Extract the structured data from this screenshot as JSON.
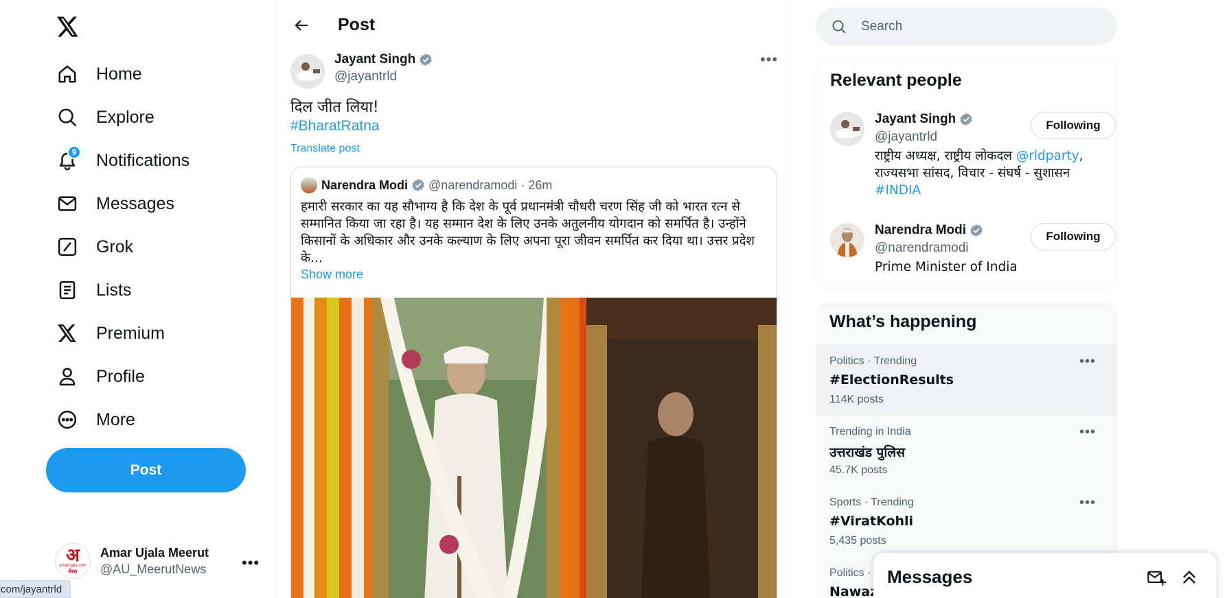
{
  "nav": {
    "items": [
      {
        "label": "Home",
        "icon": "home-icon"
      },
      {
        "label": "Explore",
        "icon": "search-icon"
      },
      {
        "label": "Notifications",
        "icon": "bell-icon",
        "badge": "9"
      },
      {
        "label": "Messages",
        "icon": "envelope-icon"
      },
      {
        "label": "Grok",
        "icon": "grok-icon"
      },
      {
        "label": "Lists",
        "icon": "list-icon"
      },
      {
        "label": "Premium",
        "icon": "x-logo-icon"
      },
      {
        "label": "Profile",
        "icon": "person-icon"
      },
      {
        "label": "More",
        "icon": "more-circle-icon"
      }
    ],
    "post_button": "Post"
  },
  "account": {
    "name": "Amar Ujala Meerut",
    "handle": "@AU_MeerutNews",
    "avatar_text": "अ",
    "avatar_sub": "amarujala.com",
    "avatar_city": "मेरठ"
  },
  "status_url": "com/jayantrld",
  "main": {
    "title": "Post",
    "post": {
      "author_name": "Jayant Singh",
      "author_handle": "@jayantrld",
      "text": "दिल जीत लिया!",
      "hashtag": "#BharatRatna",
      "translate": "Translate post",
      "quote": {
        "name": "Narendra Modi",
        "handle": "@narendramodi",
        "time": "· 26m",
        "body": "हमारी सरकार का यह सौभाग्य है कि देश के पूर्व प्रधानमंत्री चौधरी चरण सिंह जी को भारत रत्न से सम्मानित किया जा रहा है। यह सम्मान देश के लिए उनके अतुलनीय योगदान को समर्पित है। उन्होंने किसानों के अधिकार और उनके कल्याण के लिए अपना पूरा जीवन समर्पित कर दिया था। उत्तर प्रदेश के...",
        "show_more": "Show more"
      }
    }
  },
  "search": {
    "placeholder": "Search"
  },
  "relevant": {
    "title": "Relevant people",
    "people": [
      {
        "name": "Jayant Singh",
        "handle": "@jayantrld",
        "bio_pre": "राष्ट्रीय अध्यक्ष, राष्ट्रीय लोकदल ",
        "bio_link": "@rldparty",
        "bio_mid": ", राज्यसभा सांसद, विचार - संघर्ष - सुशासन ",
        "bio_link2": "#INDIA",
        "button": "Following"
      },
      {
        "name": "Narendra Modi",
        "handle": "@narendramodi",
        "bio_pre": "Prime Minister of India",
        "button": "Following"
      }
    ]
  },
  "trends": {
    "title": "What’s happening",
    "items": [
      {
        "meta": "Politics · Trending",
        "name": "#ElectionResults",
        "count": "114K posts"
      },
      {
        "meta": "Trending in India",
        "name": "उत्तराखंड पुलिस",
        "count": "45.7K posts"
      },
      {
        "meta": "Sports · Trending",
        "name": "#ViratKohli",
        "count": "5,435 posts"
      },
      {
        "meta": "Politics ·",
        "name": "Nawaz",
        "count": ""
      }
    ]
  },
  "messages_drawer": {
    "title": "Messages"
  },
  "colors": {
    "accent": "#1d9bf0",
    "text": "#0f1419",
    "muted": "#536471"
  }
}
